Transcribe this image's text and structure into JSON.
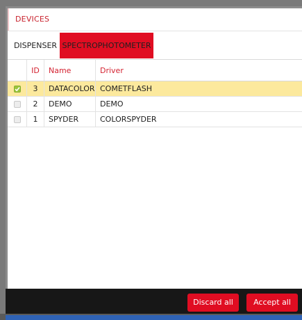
{
  "panel": {
    "title": "DEVICES"
  },
  "tabs": [
    {
      "label": "DISPENSER",
      "active": false
    },
    {
      "label": "SPECTROPHOTOMETER",
      "active": true
    }
  ],
  "table": {
    "columns": [
      "",
      "ID",
      "Name",
      "Driver"
    ],
    "rows": [
      {
        "checked": true,
        "id": "3",
        "name": "DATACOLOR",
        "driver": "COMETFLASH",
        "selected": true
      },
      {
        "checked": false,
        "id": "2",
        "name": "DEMO",
        "driver": "DEMO",
        "selected": false
      },
      {
        "checked": false,
        "id": "1",
        "name": "SPYDER",
        "driver": "COLORSPYDER",
        "selected": false
      }
    ]
  },
  "footer": {
    "discard_label": "Discard all",
    "accept_label": "Accept all"
  },
  "colors": {
    "accent": "#e00d22",
    "header_text": "#d42331",
    "selected_row": "#fce99d",
    "checkbox_checked": "#9bc53d",
    "footer_bg": "#171717"
  }
}
